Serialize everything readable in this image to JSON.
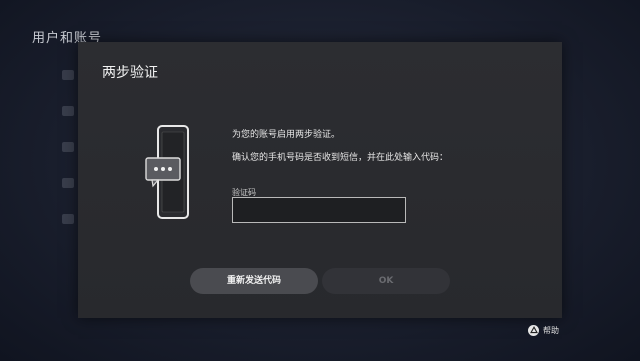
{
  "background": {
    "page_title": "用户和账号"
  },
  "dialog": {
    "title": "两步验证",
    "message_line1": "为您的账号启用两步验证。",
    "message_line2": "确认您的手机号码是否收到短信，并在此处输入代码：",
    "code_field": {
      "label": "验证码",
      "value": ""
    },
    "buttons": {
      "resend": "重新发送代码",
      "ok": "OK"
    }
  },
  "footer": {
    "help_label": "帮助",
    "help_icon": "triangle-button-icon"
  },
  "colors": {
    "dialog_bg": "#2b2c30",
    "button_active": "#4a4b50",
    "button_disabled": "#323338"
  }
}
